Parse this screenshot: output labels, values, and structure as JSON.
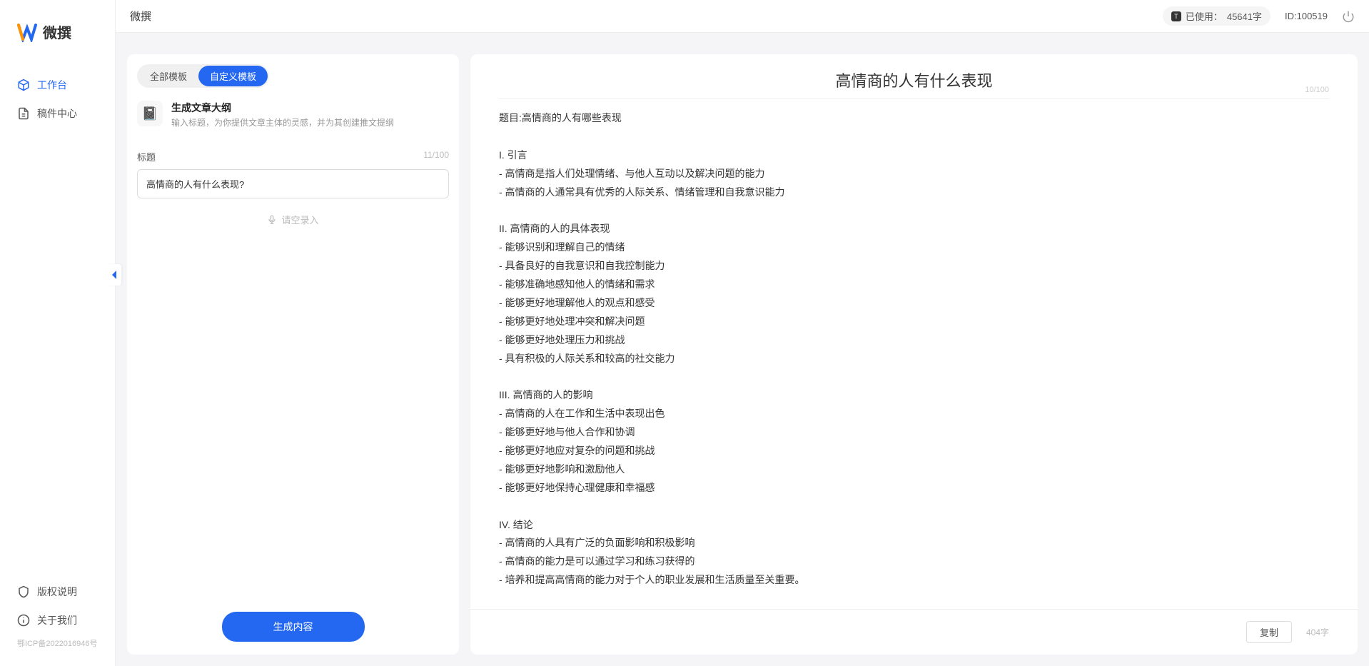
{
  "app": {
    "name": "微撰"
  },
  "logo": {
    "text": "微撰"
  },
  "sidebar": {
    "items": [
      {
        "label": "工作台"
      },
      {
        "label": "稿件中心"
      }
    ],
    "footer": [
      {
        "label": "版权说明"
      },
      {
        "label": "关于我们"
      }
    ],
    "icp": "鄂ICP备2022016946号"
  },
  "topbar": {
    "usage_prefix": "已使用： ",
    "usage_value": "45641字",
    "id_label": "ID:100519"
  },
  "tabs": {
    "all": "全部模板",
    "custom": "自定义模板"
  },
  "template": {
    "icon": "📓",
    "title": "生成文章大纲",
    "sub": "输入标题，为你提供文章主体的灵感，并为其创建推文提纲"
  },
  "field": {
    "label": "标题",
    "count": "11/100",
    "value": "高情商的人有什么表现?",
    "voice": "请空录入"
  },
  "buttons": {
    "generate": "生成内容",
    "copy": "复制"
  },
  "result": {
    "title": "高情商的人有什么表现",
    "head_count": "10/100",
    "body": "题目:高情商的人有哪些表现\n\nI. 引言\n- 高情商是指人们处理情绪、与他人互动以及解决问题的能力\n- 高情商的人通常具有优秀的人际关系、情绪管理和自我意识能力\n\nII. 高情商的人的具体表现\n- 能够识别和理解自己的情绪\n- 具备良好的自我意识和自我控制能力\n- 能够准确地感知他人的情绪和需求\n- 能够更好地理解他人的观点和感受\n- 能够更好地处理冲突和解决问题\n- 能够更好地处理压力和挑战\n- 具有积极的人际关系和较高的社交能力\n\nIII. 高情商的人的影响\n- 高情商的人在工作和生活中表现出色\n- 能够更好地与他人合作和协调\n- 能够更好地应对复杂的问题和挑战\n- 能够更好地影响和激励他人\n- 能够更好地保持心理健康和幸福感\n\nIV. 结论\n- 高情商的人具有广泛的负面影响和积极影响\n- 高情商的能力是可以通过学习和练习获得的\n- 培养和提高高情商的能力对于个人的职业发展和生活质量至关重要。",
    "word_count": "404字"
  }
}
